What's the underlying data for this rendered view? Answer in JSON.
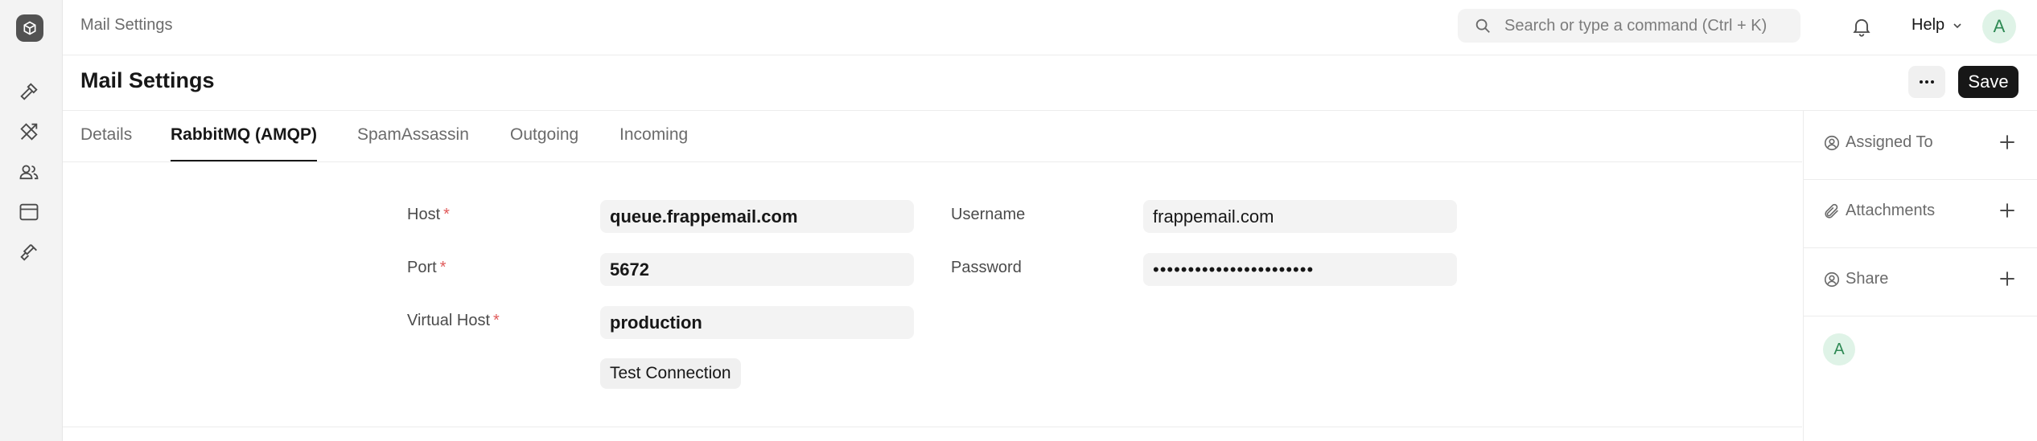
{
  "breadcrumb": "Mail Settings",
  "search": {
    "placeholder": "Search or type a command (Ctrl + K)"
  },
  "help_label": "Help",
  "user_initial": "A",
  "page_title": "Mail Settings",
  "actions": {
    "more_label": "···",
    "save_label": "Save"
  },
  "tabs": [
    {
      "label": "Details",
      "active": false
    },
    {
      "label": "RabbitMQ (AMQP)",
      "active": true
    },
    {
      "label": "SpamAssassin",
      "active": false
    },
    {
      "label": "Outgoing",
      "active": false
    },
    {
      "label": "Incoming",
      "active": false
    }
  ],
  "form": {
    "host": {
      "label": "Host",
      "value": "queue.frappemail.com",
      "required": "*"
    },
    "port": {
      "label": "Port",
      "value": "5672",
      "required": "*"
    },
    "virtual_host": {
      "label": "Virtual Host",
      "value": "production",
      "required": "*"
    },
    "username": {
      "label": "Username",
      "value": "frappemail.com"
    },
    "password": {
      "label": "Password",
      "value": "•••••••••••••••••••••••"
    },
    "test_connection_label": "Test Connection"
  },
  "right_panel": {
    "assigned_to": "Assigned To",
    "attachments": "Attachments",
    "share": "Share",
    "avatar_initial": "A"
  },
  "colors": {
    "accent": "#171717",
    "required": "#e05a5a",
    "avatar_bg": "#dff3e7",
    "avatar_text": "#2f8a55"
  },
  "icons": {
    "sidebar": [
      "app-logo-icon",
      "hammer-icon",
      "tools-icon",
      "users-icon",
      "window-icon",
      "plug-icon"
    ],
    "topbar": [
      "search-icon",
      "bell-icon",
      "chevron-down-icon"
    ],
    "right_panel": [
      "assign-icon",
      "paperclip-icon",
      "share-icon",
      "plus-icon"
    ]
  }
}
